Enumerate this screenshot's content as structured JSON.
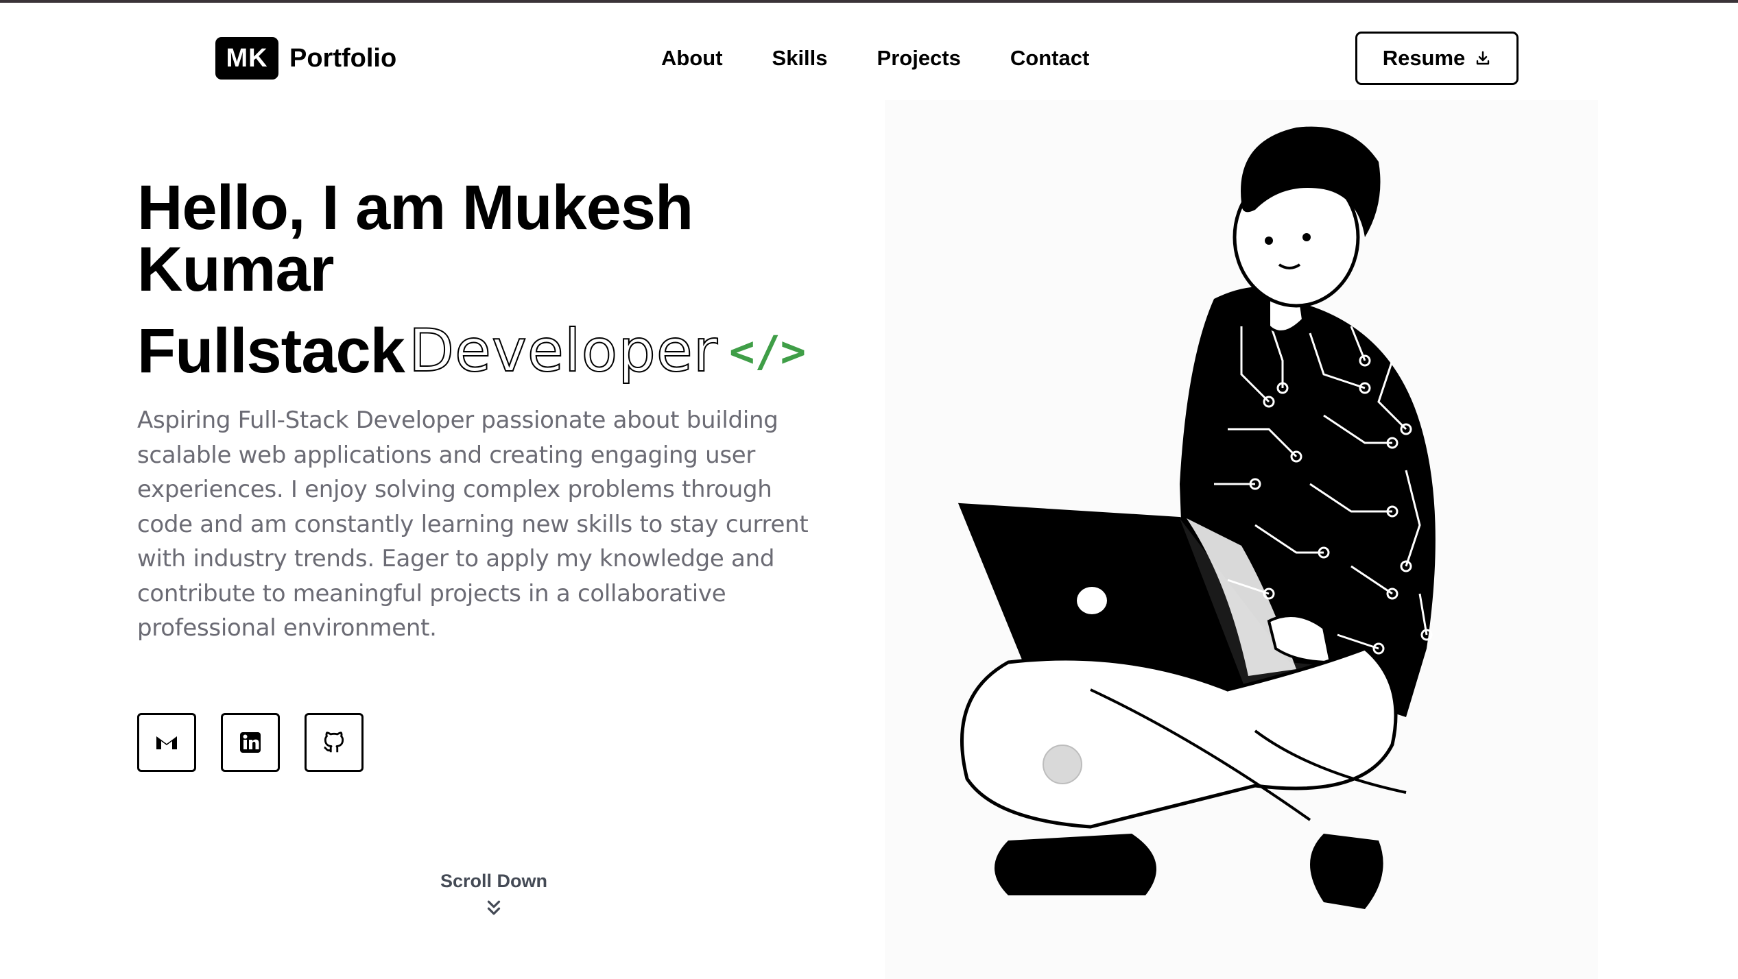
{
  "nav": {
    "logo_badge": "MK",
    "logo_text": "Portfolio",
    "links": [
      "About",
      "Skills",
      "Projects",
      "Contact"
    ],
    "resume_label": "Resume"
  },
  "hero": {
    "title": "Hello, I am Mukesh Kumar",
    "role_main": "Fullstack",
    "role_outline": "Developer",
    "role_code": "</>",
    "bio": "Aspiring Full-Stack Developer passionate about building scalable web applications and creating engaging user experiences. I enjoy solving complex problems through code and am constantly learning new skills to stay current with industry trends. Eager to apply my knowledge and contribute to meaningful projects in a collaborative professional environment."
  },
  "socials": [
    {
      "icon": "gmail-icon"
    },
    {
      "icon": "linkedin-icon"
    },
    {
      "icon": "github-icon"
    }
  ],
  "scroll": {
    "label": "Scroll Down"
  },
  "colors": {
    "accent_green": "#3f9e47",
    "text_gray": "#6b6b74",
    "border": "#000000"
  }
}
